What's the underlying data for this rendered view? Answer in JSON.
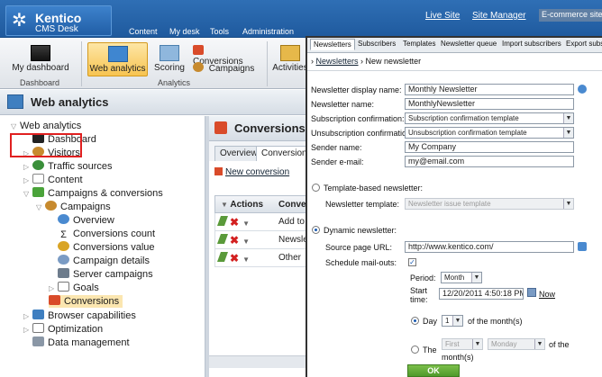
{
  "app": {
    "logo_title": "Kentico",
    "logo_subtitle": "CMS Desk"
  },
  "top_tabs": [
    "Content",
    "My desk",
    "Tools",
    "Administration"
  ],
  "top_links": {
    "live_site": "Live Site",
    "site_manager": "Site Manager",
    "ecommerce": "E-commerce site"
  },
  "ribbon": {
    "my_dashboard": "My dashboard",
    "web_analytics": "Web analytics",
    "scoring": "Scoring",
    "conversions": "Conversions",
    "campaigns": "Campaigns",
    "activities": "Activities",
    "group_dashboard": "Dashboard",
    "group_analytics": "Analytics"
  },
  "page_title": "Web analytics",
  "tree": {
    "root": "Web analytics",
    "dashboard": "Dashboard",
    "visitors": "Visitors",
    "traffic_sources": "Traffic sources",
    "content": "Content",
    "campaigns_conversions": "Campaigns & conversions",
    "campaigns": "Campaigns",
    "overview": "Overview",
    "conversions_count": "Conversions count",
    "conversions_value": "Conversions value",
    "campaign_details": "Campaign details",
    "server_campaigns": "Server campaigns",
    "goals": "Goals",
    "conversions": "Conversions",
    "browser_capabilities": "Browser capabilities",
    "optimization": "Optimization",
    "data_management": "Data management"
  },
  "conversions_panel": {
    "title": "Conversions",
    "tab_overview": "Overview",
    "tab_conversions": "Conversions",
    "new_conversion": "New conversion",
    "col_actions": "Actions",
    "col_conversion": "Conver",
    "rows": [
      "Add to c",
      "Newsle",
      "Other"
    ]
  },
  "dialog": {
    "tabs": [
      "Newsletters",
      "Subscribers",
      "Templates",
      "Newsletter queue",
      "Import subscribers",
      "Export subsc"
    ],
    "crumb_link": "Newsletters",
    "crumb_current": "New newsletter",
    "labels": {
      "display_name": "Newsletter display name:",
      "name": "Newsletter name:",
      "sub_conf": "Subscription confirmation:",
      "unsub_conf": "Unsubscription confirmation:",
      "sender_name": "Sender name:",
      "sender_email": "Sender e-mail:",
      "template_based": "Template-based newsletter:",
      "newsletter_template": "Newsletter template:",
      "dynamic": "Dynamic newsletter:",
      "source_url": "Source page URL:",
      "schedule": "Schedule mail-outs:",
      "period": "Period:",
      "start_time": "Start time:",
      "now": "Now",
      "day": "Day",
      "of_month": "of the month(s)",
      "the": "The",
      "of_the": "of the",
      "months": "month(s)"
    },
    "values": {
      "display_name": "Monthly Newsletter",
      "name": "MonthlyNewsletter",
      "sub_conf": "Subscription confirmation template",
      "unsub_conf": "Unsubscription confirmation template",
      "sender_name": "My Company",
      "sender_email": "my@email.com",
      "newsletter_template": "Newsletter issue template",
      "source_url": "http://www.kentico.com/",
      "period": "Month",
      "start_time": "12/20/2011 4:50:18 PM",
      "day": "1",
      "the_first": "First",
      "the_day": "Monday"
    },
    "ok": "OK"
  }
}
